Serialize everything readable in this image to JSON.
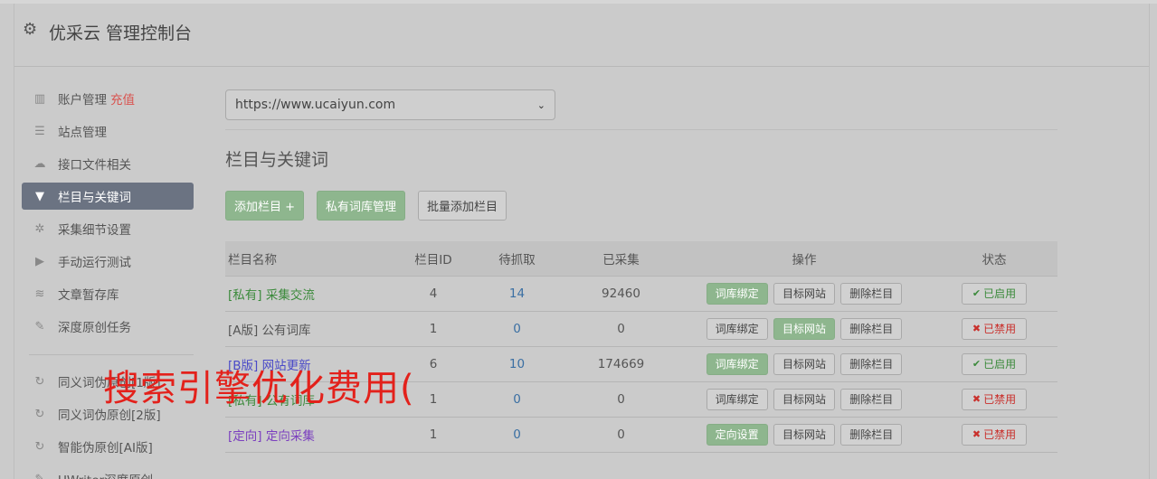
{
  "header": {
    "title": "优采云 管理控制台",
    "icon": "gear-icon"
  },
  "sidebar": {
    "items": [
      {
        "label": "账户管理",
        "extra": "充值",
        "icon": "bar-chart-icon"
      },
      {
        "label": "站点管理",
        "icon": "server-icon"
      },
      {
        "label": "接口文件相关",
        "icon": "cloud-upload-icon"
      },
      {
        "label": "栏目与关键词",
        "icon": "filter-icon",
        "active": true
      },
      {
        "label": "采集细节设置",
        "icon": "cogs-icon"
      },
      {
        "label": "手动运行测试",
        "icon": "play-circle-icon"
      },
      {
        "label": "文章暂存库",
        "icon": "database-icon"
      },
      {
        "label": "深度原创任务",
        "icon": "edit-icon"
      }
    ],
    "items2": [
      {
        "label": "同义词伪原创[1版]",
        "icon": "refresh-icon"
      },
      {
        "label": "同义词伪原创[2版]",
        "icon": "refresh-icon"
      },
      {
        "label": "智能伪原创[AI版]",
        "icon": "refresh-icon"
      },
      {
        "label": "UWriter深度原创",
        "icon": "edit-icon"
      }
    ]
  },
  "main": {
    "site_select": "https://www.ucaiyun.com",
    "section_title": "栏目与关键词",
    "buttons": {
      "add": "添加栏目 +",
      "private_lib": "私有词库管理",
      "batch_add": "批量添加栏目"
    },
    "table": {
      "headers": [
        "栏目名称",
        "栏目ID",
        "待抓取",
        "已采集",
        "操作",
        "状态"
      ],
      "rows": [
        {
          "name": "[私有] 采集交流",
          "id": "4",
          "pending": "14",
          "collected": "92460",
          "op1": "词库绑定",
          "op2": "目标网站",
          "op3": "删除栏目",
          "status": "已启用"
        },
        {
          "name": "[A版] 公有词库",
          "id": "1",
          "pending": "0",
          "collected": "0",
          "op1": "词库绑定",
          "op2": "目标网站",
          "op3": "删除栏目",
          "status": "已禁用"
        },
        {
          "name": "[B版] 网站更新",
          "id": "6",
          "pending": "10",
          "collected": "174669",
          "op1": "词库绑定",
          "op2": "目标网站",
          "op3": "删除栏目",
          "status": "已启用"
        },
        {
          "name": "[私有] 公有词库",
          "id": "1",
          "pending": "0",
          "collected": "0",
          "op1": "词库绑定",
          "op2": "目标网站",
          "op3": "删除栏目",
          "status": "已禁用"
        },
        {
          "name": "[定向] 定向采集",
          "id": "1",
          "pending": "0",
          "collected": "0",
          "op1": "定向设置",
          "op2": "目标网站",
          "op3": "删除栏目",
          "status": "已禁用"
        }
      ]
    }
  },
  "overlay_text": "搜索引擎优化费用("
}
